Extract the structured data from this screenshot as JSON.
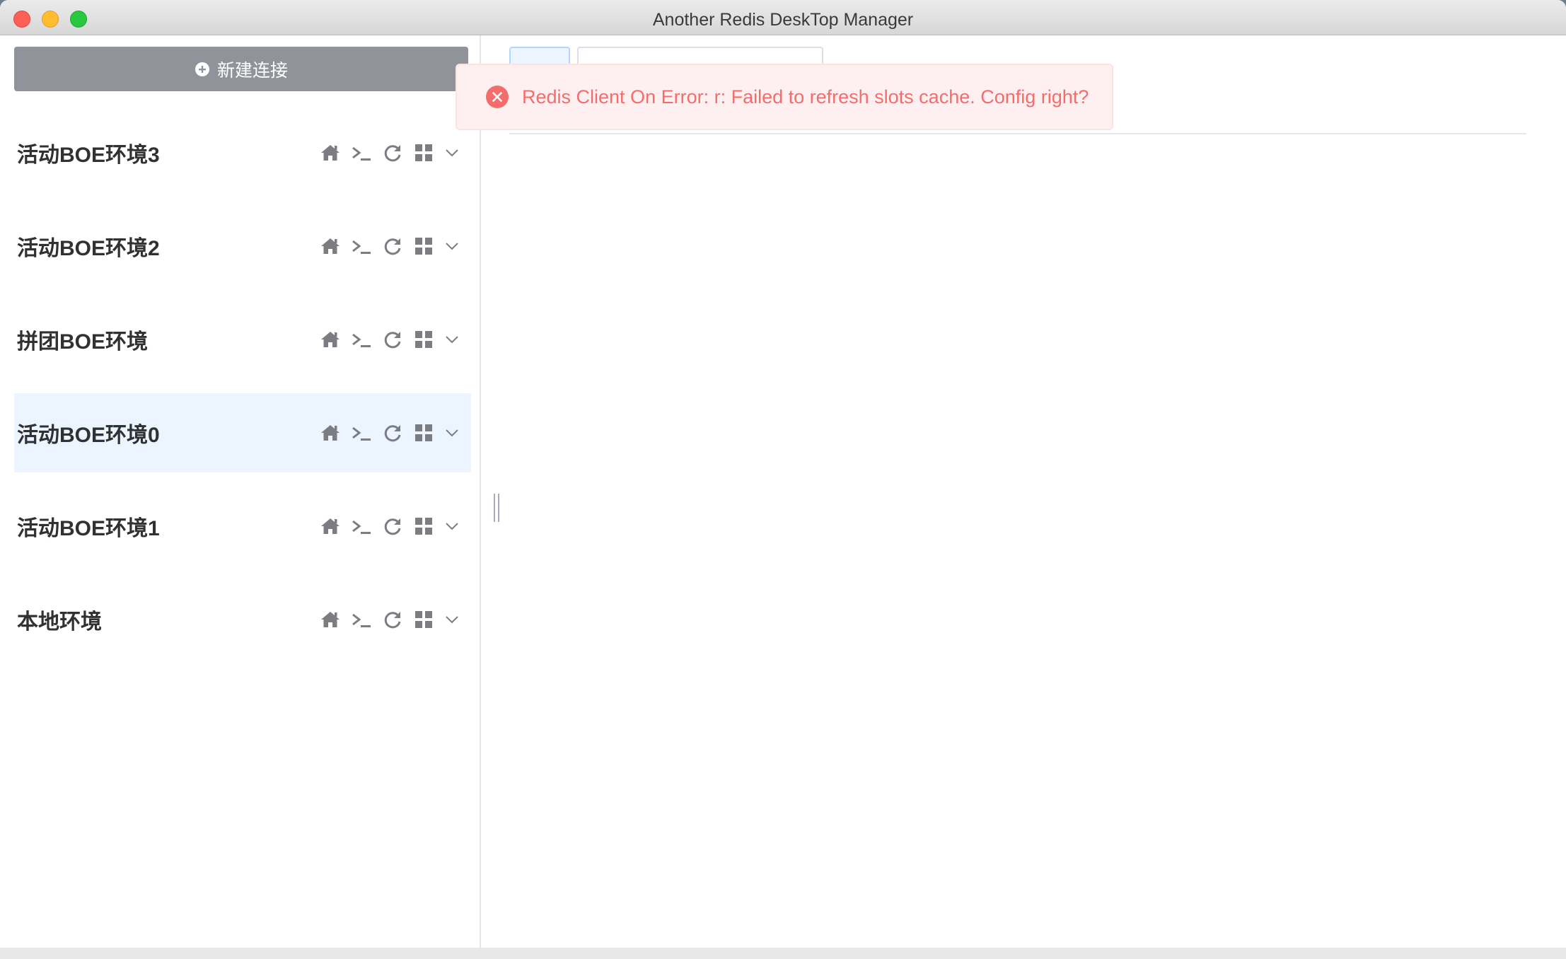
{
  "window": {
    "title": "Another Redis DeskTop Manager"
  },
  "sidebar": {
    "new_connection_label": "新建连接",
    "connections": [
      {
        "name": "活动BOE环境3",
        "active": false
      },
      {
        "name": "活动BOE环境2",
        "active": false
      },
      {
        "name": "拼团BOE环境",
        "active": false
      },
      {
        "name": "活动BOE环境0",
        "active": true
      },
      {
        "name": "活动BOE环境1",
        "active": false
      },
      {
        "name": "本地环境",
        "active": false
      }
    ],
    "item_icons": [
      "home-icon",
      "terminal-icon",
      "refresh-icon",
      "grid-icon",
      "chevron-down-icon"
    ]
  },
  "notification": {
    "type": "error",
    "text": "Redis Client On Error: r: Failed to refresh slots cache. Config right?"
  },
  "colors": {
    "sidebar_button": "#909399",
    "active_item_bg": "#ecf5ff",
    "error_text": "#f56c6c",
    "error_bg": "#fef0f0",
    "icon_gray": "#7b7d82"
  }
}
